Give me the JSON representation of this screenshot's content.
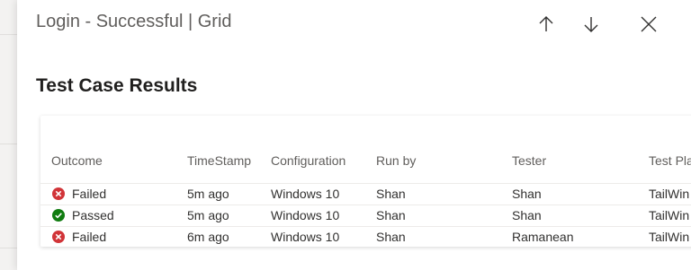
{
  "panel": {
    "title": "Login - Successful | Grid",
    "prev_icon": "arrow-up-icon",
    "next_icon": "arrow-down-icon",
    "close_icon": "close-icon"
  },
  "section": {
    "title": "Test Case Results"
  },
  "grid": {
    "columns": [
      "Outcome",
      "TimeStamp",
      "Configuration",
      "Run by",
      "Tester",
      "Test Pla"
    ],
    "rows": [
      {
        "outcome": "Failed",
        "status": "failed",
        "timestamp": "5m ago",
        "configuration": "Windows 10",
        "run_by": "Shan",
        "tester": "Shan",
        "test_plan": "TailWin"
      },
      {
        "outcome": "Passed",
        "status": "passed",
        "timestamp": "5m ago",
        "configuration": "Windows 10",
        "run_by": "Shan",
        "tester": "Shan",
        "test_plan": "TailWin"
      },
      {
        "outcome": "Failed",
        "status": "failed",
        "timestamp": "6m ago",
        "configuration": "Windows 10",
        "run_by": "Shan",
        "tester": "Ramanean",
        "test_plan": "TailWin"
      }
    ]
  },
  "colors": {
    "failed": "#d13438",
    "passed": "#107c10",
    "title": "#605e5c",
    "text": "#323130"
  }
}
